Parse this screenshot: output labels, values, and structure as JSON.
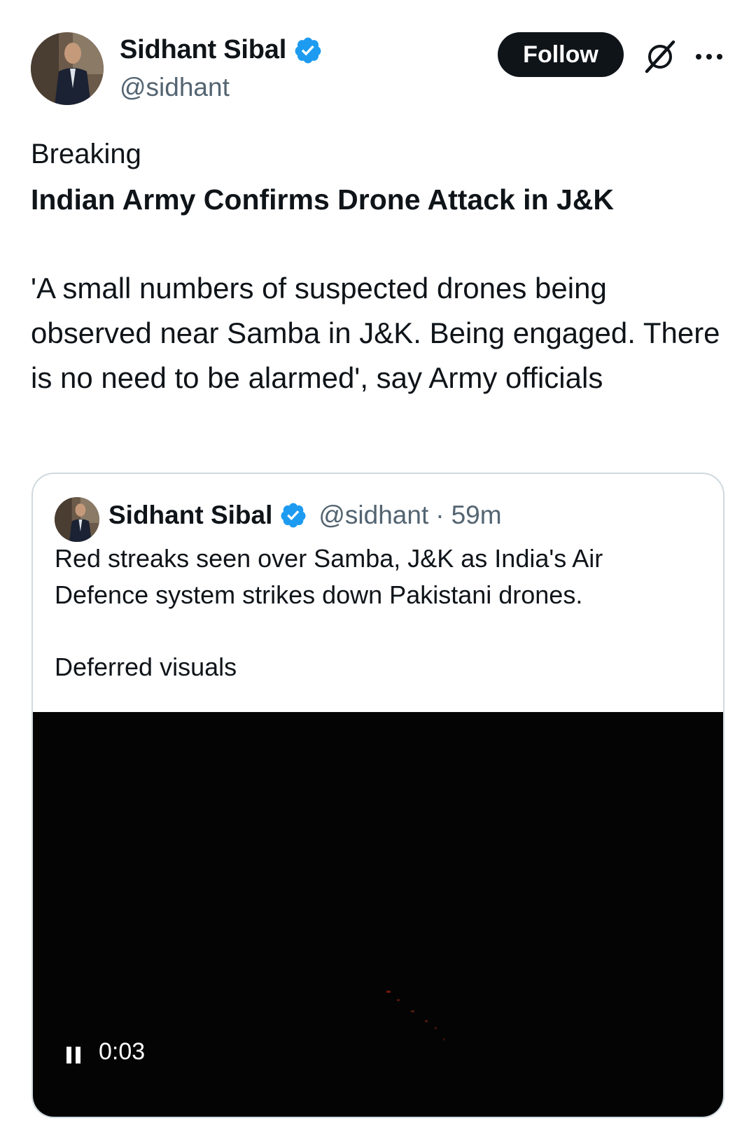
{
  "tweet": {
    "author_name": "Sidhant Sibal",
    "handle": "@sidhant",
    "follow_label": "Follow",
    "label": "Breaking",
    "headline": "Indian Army Confirms Drone Attack in J&K",
    "body": "'A small numbers of suspected drones being observed near Samba in J&K. Being engaged. There is no need to be alarmed', say Army officials"
  },
  "quote": {
    "author_name": "Sidhant Sibal",
    "handle": "@sidhant",
    "separator": "·",
    "time": "59m",
    "text": "Red streaks seen over Samba, J&K as India's Air Defence system strikes down Pakistani drones.",
    "text2": "Deferred visuals"
  },
  "video": {
    "timecode": "0:03",
    "state": "playing"
  },
  "icons": {
    "verified": "verified-badge-icon",
    "grok": "grok-icon",
    "more": "more-icon",
    "pause": "pause-icon"
  },
  "colors": {
    "verified": "#1d9bf0",
    "follow_bg": "#0f1419",
    "secondary_text": "#536471",
    "border": "#cfd9de"
  }
}
